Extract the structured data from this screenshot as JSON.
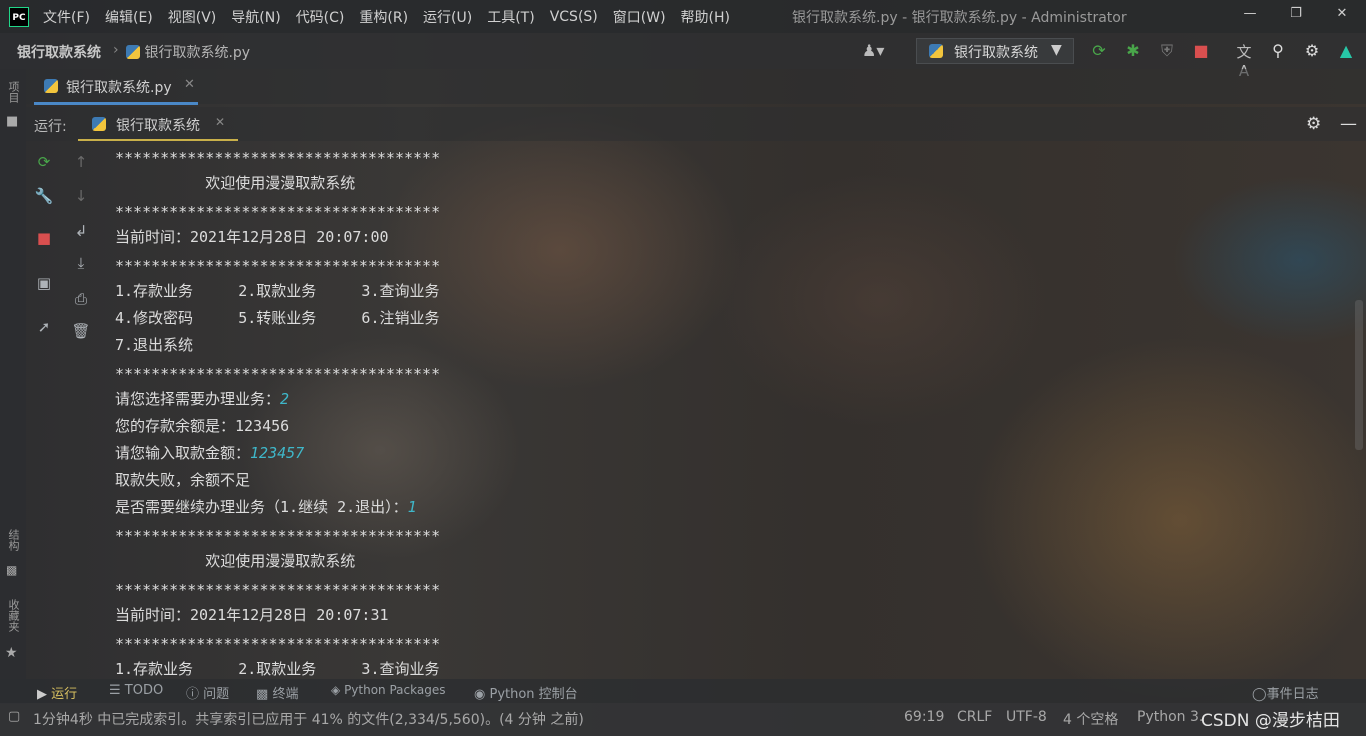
{
  "menu": [
    "文件(F)",
    "编辑(E)",
    "视图(V)",
    "导航(N)",
    "代码(C)",
    "重构(R)",
    "运行(U)",
    "工具(T)",
    "VCS(S)",
    "窗口(W)",
    "帮助(H)"
  ],
  "window_title": "银行取款系统.py - 银行取款系统.py - Administrator",
  "logo_text": "PC",
  "breadcrumb": {
    "project": "银行取款系统",
    "file": "银行取款系统.py"
  },
  "run_config": "银行取款系统",
  "editor_tab": "银行取款系统.py",
  "run_label": "运行:",
  "run_tab": "银行取款系统",
  "sidebar": {
    "project": "项目",
    "structure": "结构",
    "favorites": "收藏夹"
  },
  "console": {
    "stars": "************************************",
    "welcome": "          欢迎使用漫漫取款系统",
    "time1": "当前时间：2021年12月28日 20:07:00",
    "menu_row1": "1.存款业务     2.取款业务     3.查询业务",
    "menu_row2": "4.修改密码     5.转账业务     6.注销业务",
    "menu_row3": "7.退出系统",
    "prompt_choice": "请您选择需要办理业务：",
    "choice_value": "2",
    "balance": "您的存款余额是：123456",
    "prompt_amount": "请您输入取款金额：",
    "amount_value": "123457",
    "fail": "取款失败，余额不足",
    "prompt_continue": "是否需要继续办理业务（1.继续 2.退出）：",
    "continue_value": "1",
    "time2": "当前时间：2021年12月28日 20:07:31"
  },
  "tool_windows": {
    "run": "运行",
    "todo": "TODO",
    "problems": "问题",
    "terminal": "终端",
    "packages": "Python Packages",
    "console": "Python 控制台",
    "events": "事件日志"
  },
  "status": {
    "message": "1分钟4秒 中已完成索引。共享索引已应用于 41% 的文件(2,334/5,560)。(4 分钟 之前)",
    "position": "69:19",
    "line_sep": "CRLF",
    "encoding": "UTF-8",
    "indent": "4 个空格",
    "interpreter": "Python 3.",
    "watermark": "CSDN @漫步桔田"
  },
  "colors": {
    "accent_run": "#c9b04a",
    "input_text": "#3fb7c9",
    "rerun_green": "#49a64a",
    "stop_red": "#d94f4f"
  }
}
